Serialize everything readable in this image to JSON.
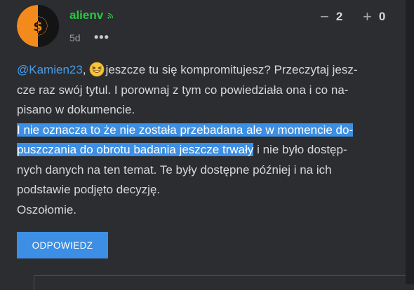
{
  "comment": {
    "username": "alienv",
    "time": "5d",
    "votes": {
      "down_sign": "−",
      "down_count": "2",
      "up_sign": "+",
      "up_count": "0"
    },
    "body": {
      "mention": "@Kamien23",
      "after_mention": ",",
      "line1_rest": "jeszcze tu się kompromitujesz? Przeczytaj jesz-",
      "line2": "cze raz swój tytul. I porownaj z tym co powiedziała ona i co na-",
      "line3": "pisano w dokumencie.",
      "highlight_line1": "I nie oznacza to że nie została przebadana ale w momencie do-",
      "highlight_line2": "puszczania do obrotu badania jeszcze trwały",
      "line5_rest": " i nie było dostęp-",
      "line6": "nych danych na ten temat. Te były dostępne później i na ich",
      "line7": "podstawie podjęto decyzję.",
      "line8": "Oszołomie."
    },
    "reply_label": "ODPOWIEDZ"
  },
  "icons": {
    "avatar": "dollar-coin-avatar",
    "rss": "rss-icon",
    "more": "more-icon",
    "emoji": "laughing-emoji-icon"
  },
  "colors": {
    "background": "#2b2d31",
    "username": "#27c93f",
    "mention": "#4a9de8",
    "highlight": "#3c8fe4",
    "button": "#3c8fe4",
    "text": "#d7d8da"
  }
}
